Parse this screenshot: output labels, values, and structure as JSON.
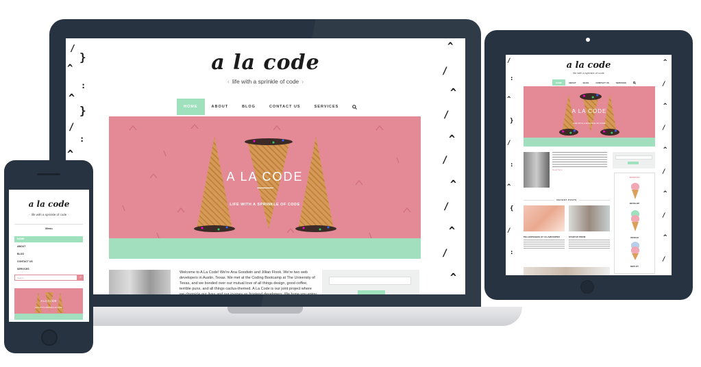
{
  "site": {
    "logo": "a la code",
    "tagline": "life with a sprinkle of code",
    "nav": [
      "HOME",
      "ABOUT",
      "BLOG",
      "CONTACT US",
      "SERVICES"
    ],
    "hero_title": "A LA CODE",
    "hero_subtitle": "LIFE WITH A SPRINKLE OF CODE",
    "intro_text": "Welcome to A La Code! We're Ana Goodwin and Jillian Flook. We're two web developers in Austin, Texas. We met at the Coding Bootcamp at The University of Texas, and we bonded over our mutual love of all things design, good coffee, terrible puns, and all things cactus-themed. A La Code is our joint project where we chronicle our lives and our journey as frontend developers. We hope you enjoy following along as"
  },
  "tablet": {
    "read_more": "Read More",
    "recent_posts_label": "RECENT POSTS",
    "services_label": "SERVICES",
    "post_titles": [
      "PELLENTESQUE AT ULLAMCORPER",
      "STARTUP PRIUM"
    ],
    "service_names": [
      "DEVELOP",
      "DESIGN",
      "DEPLOY"
    ]
  },
  "phone": {
    "menu_label": "Menu",
    "search_placeholder": "Search"
  },
  "colors": {
    "device_frame": "#283341",
    "hero_pink": "#e38a96",
    "accent_mint": "#9fe1bd"
  },
  "icons": {
    "search": "search-icon"
  }
}
